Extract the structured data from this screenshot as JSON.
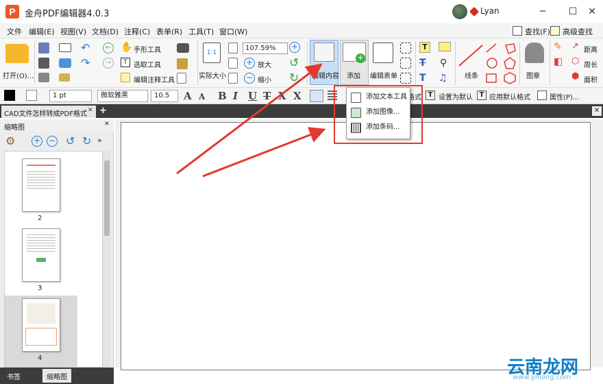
{
  "window": {
    "logo_text": "P",
    "title": "金舟PDF编辑器4.0.3",
    "user_name": "Lyan",
    "minimize": "─",
    "maximize": "☐",
    "close": "✕"
  },
  "menubar": {
    "items": [
      "文件",
      "编辑(E)",
      "视图(V)",
      "文档(D)",
      "注释(C)",
      "表单(R)",
      "工具(T)",
      "窗口(W)"
    ],
    "find_label": "查找(F)",
    "advanced_find_label": "高级查找(S)"
  },
  "ribbon": {
    "open_label": "打开(O)...",
    "hand_tool": "手形工具",
    "select_tool": "选取工具",
    "edit_annotation_tool": "编辑注释工具",
    "actual_size": "实际大小",
    "zoom_value": "107.59%",
    "zoom_in": "放大",
    "zoom_out": "缩小",
    "edit_content": "编辑内容",
    "add": "添加",
    "edit_form": "编辑表单",
    "line": "线条",
    "stamp": "图章",
    "distance": "距离",
    "perimeter": "周长",
    "area": "面积",
    "fit_glyph": "1:1"
  },
  "formatbar": {
    "line_width": "1 pt",
    "font_name": "微软雅黑",
    "font_size": "10.5 pt",
    "format_suffix": "格式",
    "set_default": "设置为默认",
    "apply_default": "应用默认格式",
    "properties": "属性(P)..."
  },
  "document_tab": {
    "title": "CAD文件怎样转成PDF格式",
    "add_tab": "+"
  },
  "sidebar": {
    "title": "缩略图",
    "pages": [
      "2",
      "3",
      "4"
    ],
    "bottom_tabs": [
      "书签",
      "缩略图"
    ]
  },
  "dropdown": {
    "items": [
      "添加文本工具",
      "添加图像...",
      "添加条码..."
    ]
  },
  "watermark": {
    "text": "云南龙网",
    "url": "www.ynlong.com"
  },
  "colors": {
    "accent_red": "#e23a2e",
    "logo_orange": "#e9582a",
    "watermark_blue": "#0d7ec7"
  }
}
